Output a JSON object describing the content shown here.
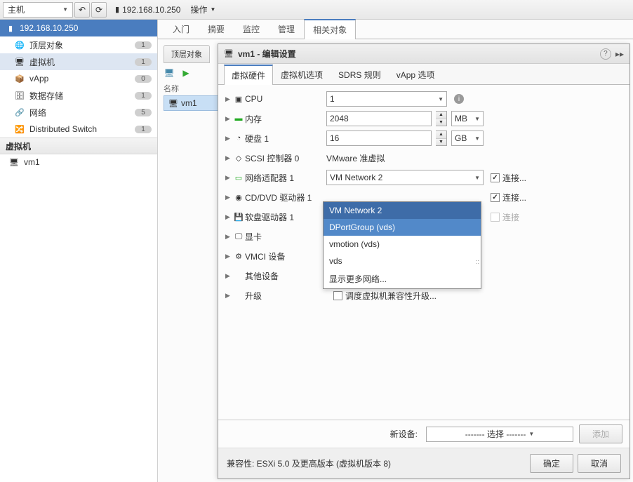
{
  "toolbar": {
    "host_label": "主机",
    "ip": "192.168.10.250",
    "operation": "操作"
  },
  "left_nav": {
    "header": "192.168.10.250",
    "items": [
      {
        "icon": "🌐",
        "label": "顶层对象",
        "badge": "1"
      },
      {
        "icon": "🖥",
        "label": "虚拟机",
        "badge": "1",
        "selected": true
      },
      {
        "icon": "📦",
        "label": "vApp",
        "badge": "0"
      },
      {
        "icon": "🗄",
        "label": "数据存储",
        "badge": "1"
      },
      {
        "icon": "🔗",
        "label": "网络",
        "badge": "5"
      },
      {
        "icon": "🔀",
        "label": "Distributed Switch",
        "badge": "1"
      }
    ],
    "section": "虚拟机",
    "sub": {
      "icon": "🖥",
      "label": "vm1"
    }
  },
  "main_tabs": [
    "入门",
    "摘要",
    "监控",
    "管理",
    "相关对象"
  ],
  "main_tab_active": 4,
  "sub_tab": "顶层对象",
  "column_header": "名称",
  "list": {
    "icon": "🖥",
    "label": "vm1"
  },
  "modal": {
    "title": "vm1 - 编辑设置",
    "tabs": [
      "虚拟硬件",
      "虚拟机选项",
      "SDRS 规则",
      "vApp 选项"
    ],
    "tab_active": 0,
    "rows": {
      "cpu": {
        "label": "CPU",
        "value": "1"
      },
      "memory": {
        "label": "内存",
        "value": "2048",
        "unit": "MB"
      },
      "disk": {
        "label": "硬盘 1",
        "value": "16",
        "unit": "GB"
      },
      "scsi": {
        "label": "SCSI 控制器 0",
        "value": "VMware 准虚拟"
      },
      "net": {
        "label": "网络适配器 1",
        "value": "VM Network 2",
        "connect": "连接..."
      },
      "cd": {
        "label": "CD/DVD 驱动器 1",
        "connect": "连接..."
      },
      "floppy": {
        "label": "软盘驱动器 1",
        "connect": "连接"
      },
      "video": {
        "label": "显卡"
      },
      "vmci": {
        "label": "VMCI 设备"
      },
      "other": {
        "label": "其他设备"
      },
      "upgrade": {
        "label": "升级",
        "checkbox": "调度虚拟机兼容性升级..."
      }
    },
    "dropdown": [
      "VM Network 2",
      "DPortGroup (vds)",
      "vmotion (vds)",
      "vds",
      "显示更多网络..."
    ],
    "new_device": {
      "label": "新设备:",
      "value": "------- 选择 -------",
      "button": "添加"
    },
    "compat": "兼容性: ESXi 5.0 及更高版本 (虚拟机版本 8)",
    "ok": "确定",
    "cancel": "取消"
  }
}
